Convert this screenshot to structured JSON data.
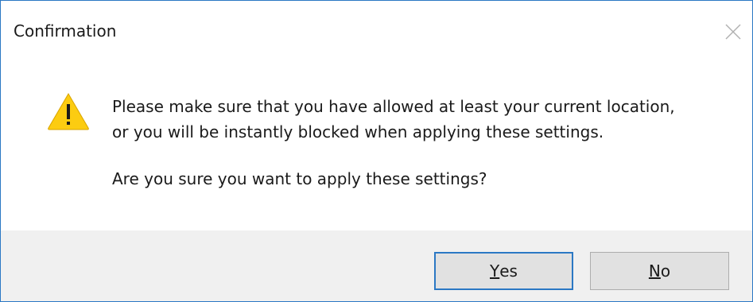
{
  "window": {
    "title": "Confirmation"
  },
  "icons": {
    "warning": "warning-icon",
    "close": "close-icon"
  },
  "message": {
    "line1": "Please make sure that you have allowed at least your current location,",
    "line2": "or you will be instantly blocked when applying these settings.",
    "question": "Are you sure you want to apply these settings?"
  },
  "buttons": {
    "yes": {
      "accel": "Y",
      "rest": "es"
    },
    "no": {
      "accel": "N",
      "rest": "o"
    }
  },
  "colors": {
    "accent": "#2b78c4",
    "footer_background": "#f0f0f0",
    "button_face": "#e1e1e1",
    "warning_yellow": "#fccc11"
  }
}
